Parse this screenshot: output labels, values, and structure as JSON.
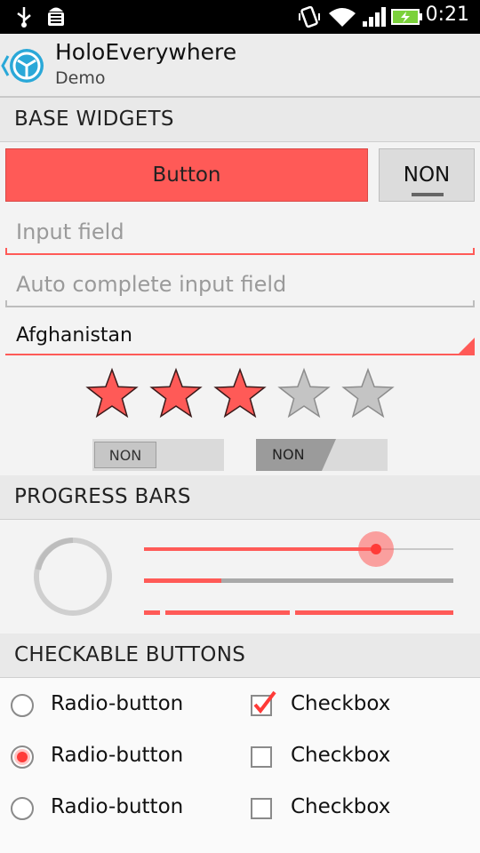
{
  "status_bar": {
    "time": "0:21"
  },
  "action_bar": {
    "title": "HoloEverywhere",
    "subtitle": "Demo"
  },
  "sections": {
    "base_widgets": "BASE WIDGETS",
    "progress_bars": "PROGRESS BARS",
    "checkable_buttons": "CHECKABLE BUTTONS"
  },
  "base_widgets": {
    "button_label": "Button",
    "toggle_label": "NON",
    "input_placeholder": "Input field",
    "autocomplete_placeholder": "Auto complete input field",
    "spinner_value": "Afghanistan",
    "rating": {
      "value": 3,
      "max": 5
    },
    "switch1_label": "NON",
    "switch2_label": "NON"
  },
  "progress": {
    "seekbar_fraction": 0.75,
    "progress_fraction": 0.25
  },
  "checkables": {
    "radios": [
      {
        "label": "Radio-button",
        "checked": false
      },
      {
        "label": "Radio-button",
        "checked": true
      },
      {
        "label": "Radio-button",
        "checked": false
      }
    ],
    "checkboxes": [
      {
        "label": "Checkbox",
        "checked": true
      },
      {
        "label": "Checkbox",
        "checked": false
      },
      {
        "label": "Checkbox",
        "checked": false
      }
    ]
  },
  "colors": {
    "accent": "#ff5a57",
    "accent_dark": "#d94a47"
  }
}
